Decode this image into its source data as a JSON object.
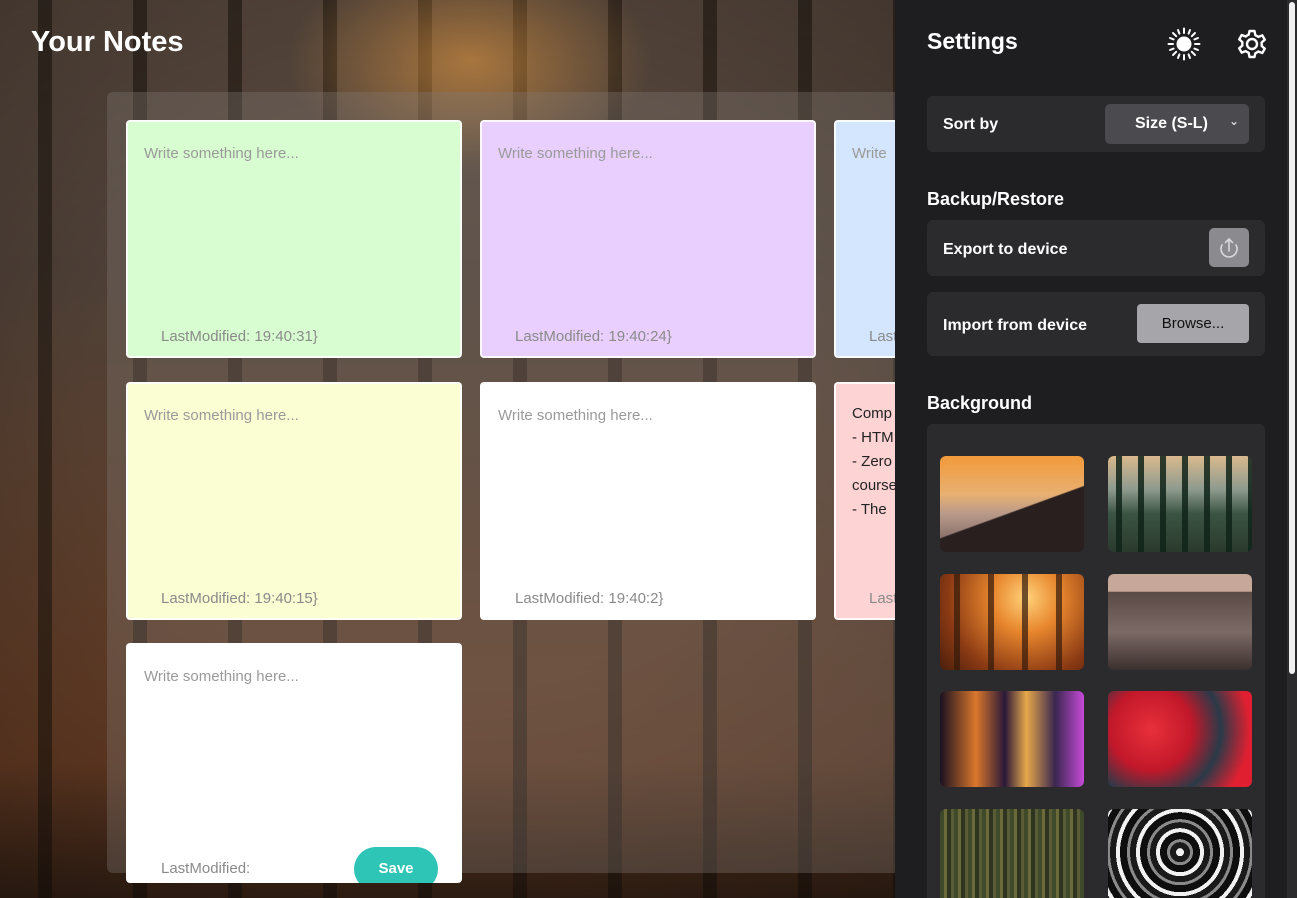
{
  "app": {
    "title": "Your Notes"
  },
  "notes": [
    {
      "placeholder": "Write something here...",
      "modified": "LastModified: 19:40:31}",
      "color": "#d8fdd0"
    },
    {
      "placeholder": "Write something here...",
      "modified": "LastModified: 19:40:24}",
      "color": "#e9cffd"
    },
    {
      "placeholder": "Write",
      "modified": "Last",
      "color": "#d3e6fd"
    },
    {
      "placeholder": "Write something here...",
      "modified": "LastModified: 19:40:15}",
      "color": "#fbfdd3"
    },
    {
      "placeholder": "Write something here...",
      "modified": "LastModified: 19:40:2}",
      "color": "#ffffff"
    },
    {
      "text_lines": [
        "Comp",
        "- HTM",
        "- Zero",
        "course",
        "- The "
      ],
      "modified": "Last",
      "color": "#fdd3d3"
    },
    {
      "placeholder": "Write something here...",
      "modified": "LastModified:",
      "color": "#ffffff",
      "save_label": "Save"
    }
  ],
  "settings": {
    "title": "Settings",
    "sort_label": "Sort by",
    "sort_value": "Size (S-L)",
    "backup_title": "Backup/Restore",
    "export_label": "Export to device",
    "import_label": "Import from device",
    "browse_label": "Browse...",
    "background_title": "Background",
    "backgrounds": [
      "mountain-sunset",
      "mountain-forest",
      "autumn-forest",
      "street-shop",
      "night-alley",
      "red-abstract",
      "tree-bark",
      "tunnel-bw"
    ]
  },
  "colors": {
    "panel": "#1e1e20",
    "card": "#2b2b2e",
    "accent": "#2ec4b6"
  }
}
